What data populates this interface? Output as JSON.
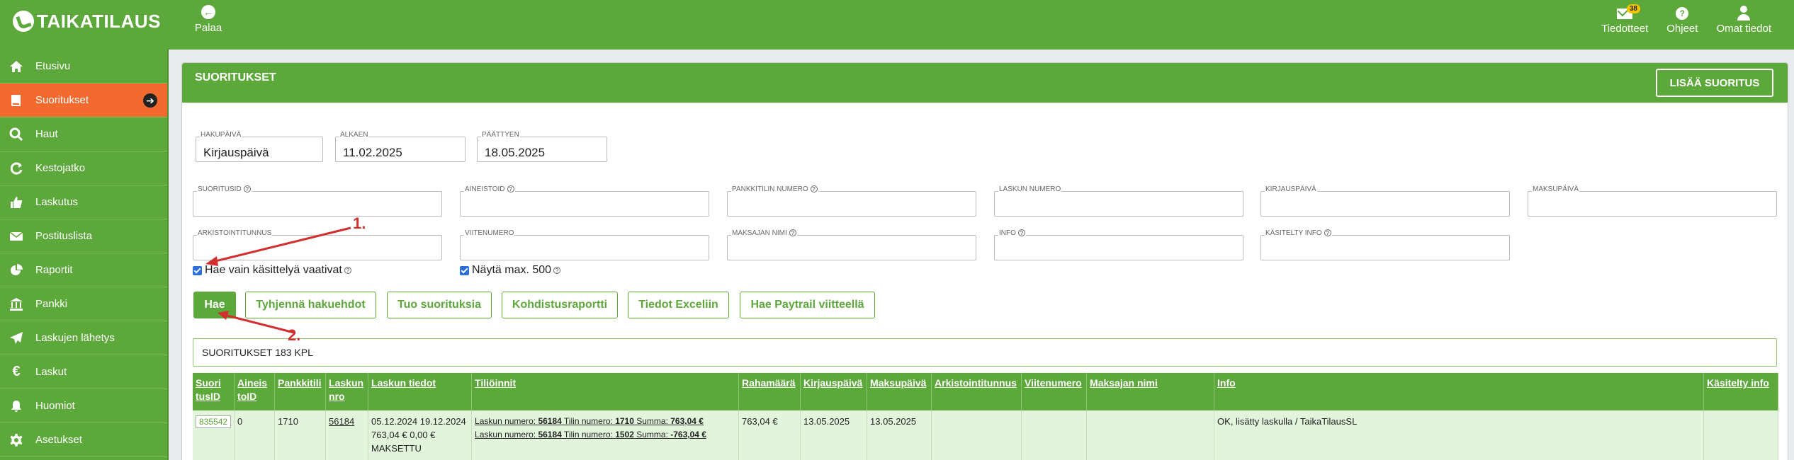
{
  "app": {
    "logo_text": "TAIKATILAUS"
  },
  "topbar": {
    "back_label": "Palaa",
    "right": [
      {
        "label": "Tiedotteet",
        "icon": "envelope-icon",
        "badge": "38"
      },
      {
        "label": "Ohjeet",
        "icon": "help-icon"
      },
      {
        "label": "Omat tiedot",
        "icon": "user-icon"
      }
    ]
  },
  "sidebar": {
    "items": [
      {
        "label": "Etusivu",
        "icon": "home-icon"
      },
      {
        "label": "Suoritukset",
        "icon": "book-icon",
        "active": true
      },
      {
        "label": "Haut",
        "icon": "search-icon"
      },
      {
        "label": "Kestojatko",
        "icon": "refresh-icon"
      },
      {
        "label": "Laskutus",
        "icon": "thumbs-up-icon"
      },
      {
        "label": "Postituslista",
        "icon": "envelope-icon"
      },
      {
        "label": "Raportit",
        "icon": "pie-chart-icon"
      },
      {
        "label": "Pankki",
        "icon": "bank-icon"
      },
      {
        "label": "Laskujen lähetys",
        "icon": "paper-plane-icon"
      },
      {
        "label": "Laskut",
        "icon": "euro-icon"
      },
      {
        "label": "Huomiot",
        "icon": "bell-icon"
      },
      {
        "label": "Asetukset",
        "icon": "gear-icon"
      }
    ]
  },
  "card": {
    "title": "SUORITUKSET",
    "add_button": "LISÄÄ SUORITUS"
  },
  "filters": {
    "hakupaiva": {
      "label": "HAKUPÄIVÄ",
      "value": "Kirjauspäivä"
    },
    "alkaen": {
      "label": "ALKAEN",
      "value": "11.02.2025"
    },
    "paattyen": {
      "label": "PÄÄTTYEN",
      "value": "18.05.2025"
    },
    "suoritusid": {
      "label": "SUORITUSID"
    },
    "aineistoid": {
      "label": "AINEISTOID"
    },
    "pankkitili": {
      "label": "PANKKITILIN NUMERO"
    },
    "laskun_numero": {
      "label": "LASKUN NUMERO"
    },
    "kirjauspaiva": {
      "label": "KIRJAUSPÄIVÄ"
    },
    "maksupaiva": {
      "label": "MAKSUPÄIVÄ"
    },
    "arkistointitunnus": {
      "label": "ARKISTOINTITUNNUS"
    },
    "viitenumero": {
      "label": "VIITENUMERO"
    },
    "maksajan_nimi": {
      "label": "MAKSAJAN NIMI"
    },
    "info": {
      "label": "INFO"
    },
    "kasitelty_info": {
      "label": "KÄSITELTY INFO"
    }
  },
  "checkboxes": {
    "vaatii_kasittelya": "Hae vain käsittelyä vaativat",
    "nayta_max": "Näytä max. 500"
  },
  "buttons": {
    "hae": "Hae",
    "tyhjenna": "Tyhjennä hakuehdot",
    "tuo": "Tuo suorituksia",
    "kohdistus": "Kohdistusraportti",
    "excel": "Tiedot Exceliin",
    "paytrail": "Hae Paytrail viitteellä"
  },
  "result_count": "SUORITUKSET 183 KPL",
  "table": {
    "headers": [
      "Suori tusID",
      "Aineis toID",
      "Pankkitili",
      "Laskun nro",
      "Laskun tiedot",
      "Tiliöinnit",
      "Rahamäärä",
      "Kirjauspäivä",
      "Maksupäivä",
      "Arkistointitunnus",
      "Viitenumero",
      "Maksajan nimi",
      "Info",
      "Käsitelty info"
    ],
    "row": {
      "suoritusid": "835542",
      "aineistoid": "0",
      "pankkitili": "1710",
      "laskun_nro": "56184",
      "laskun_tiedot_1": "05.12.2024 19.12.2024",
      "laskun_tiedot_2": "763,04 € 0,00 €",
      "laskun_tiedot_3": "MAKSETTU",
      "tilioinnit": [
        {
          "a": "Laskun numero: ",
          "nro": "56184",
          "b": " Tilin numero: ",
          "tili": "1710",
          "c": " Summa: ",
          "summa": "763,04 €"
        },
        {
          "a": "Laskun numero: ",
          "nro": "56184",
          "b": " Tilin numero: ",
          "tili": "1502",
          "c": " Summa: ",
          "summa": "-763,04 €"
        }
      ],
      "rahamaara": "763,04 €",
      "kirjauspaiva": "13.05.2025",
      "maksupaiva": "13.05.2025",
      "arkistointitunnus": "",
      "viitenumero": "",
      "maksajan_nimi": "",
      "info": "OK, lisätty laskulla / TaikaTilausSL",
      "kasitelty_info": ""
    }
  },
  "annotations": {
    "one": "1.",
    "two": "2."
  },
  "colors": {
    "brand_green": "#5da83b",
    "active_orange": "#f26a2e",
    "annotation_red": "#d32f2f"
  }
}
